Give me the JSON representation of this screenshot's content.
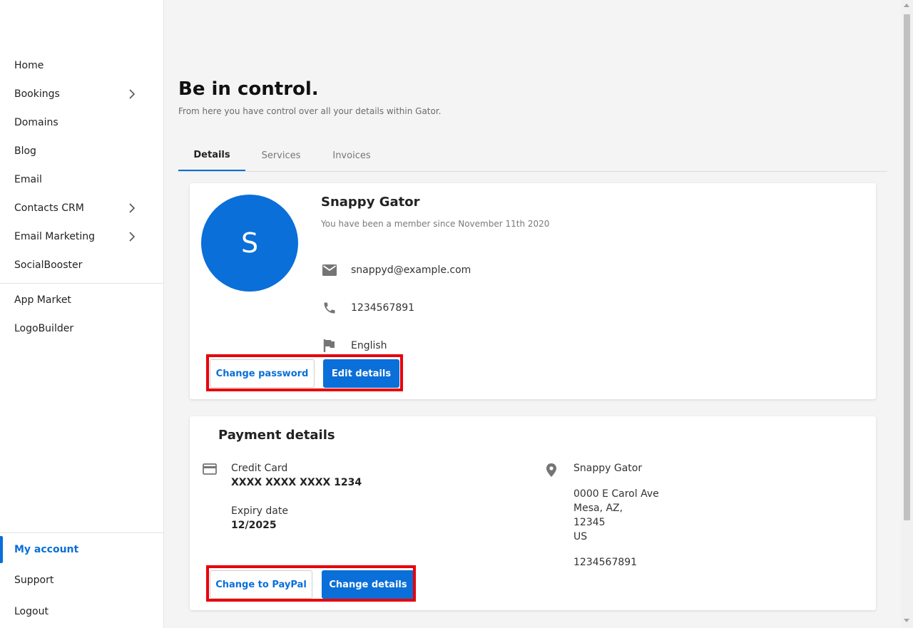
{
  "sidebar": {
    "items": [
      {
        "label": "Home"
      },
      {
        "label": "Bookings"
      },
      {
        "label": "Domains"
      },
      {
        "label": "Blog"
      },
      {
        "label": "Email"
      },
      {
        "label": "Contacts CRM"
      },
      {
        "label": "Email Marketing"
      },
      {
        "label": "SocialBooster"
      }
    ],
    "secondary_items": [
      {
        "label": "App Market"
      },
      {
        "label": "LogoBuilder"
      }
    ],
    "bottom_items": [
      {
        "label": "My account"
      },
      {
        "label": "Support"
      },
      {
        "label": "Logout"
      }
    ]
  },
  "header": {
    "title": "Be in control.",
    "subtitle": "From here you have control over all your details within Gator."
  },
  "tabs": [
    {
      "label": "Details"
    },
    {
      "label": "Services"
    },
    {
      "label": "Invoices"
    }
  ],
  "profile": {
    "avatar_initial": "S",
    "name": "Snappy Gator",
    "member_since": "You have been a member since November 11th 2020",
    "email": "snappyd@example.com",
    "phone": "1234567891",
    "language": "English",
    "change_password_label": "Change password",
    "edit_details_label": "Edit details"
  },
  "payment": {
    "title": "Payment details",
    "method_label": "Credit Card",
    "card_number": "XXXX XXXX XXXX 1234",
    "expiry_label": "Expiry date",
    "expiry_value": "12/2025",
    "billing_name": "Snappy Gator",
    "address_line1": "0000 E Carol Ave",
    "address_line2": "Mesa, AZ,",
    "address_line3": "12345",
    "address_line4": "US",
    "billing_phone": "1234567891",
    "change_paypal_label": "Change to PayPal",
    "change_details_label": "Change details"
  },
  "colors": {
    "accent": "#0a6fd8",
    "highlight": "#e8000b",
    "background": "#f4f4f4"
  },
  "icons": {
    "email": "mail-icon",
    "phone": "phone-icon",
    "language": "flag-icon",
    "card": "credit-card-icon",
    "address": "location-pin-icon",
    "expand": "chevron-right-icon"
  }
}
